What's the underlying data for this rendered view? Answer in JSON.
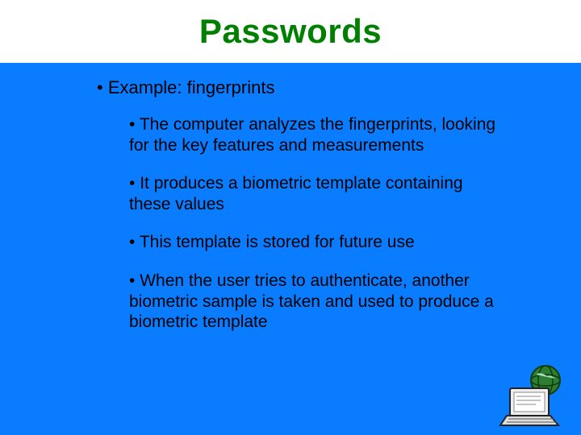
{
  "title": "Passwords",
  "example_label": "Example:  fingerprints",
  "sub_bullets": [
    "The computer analyzes the fingerprints, looking for the key features and measurements",
    "It produces a biometric template containing these values",
    "This template is stored for future use",
    "When the user tries to authenticate, another biometric sample is taken and used to produce a biometric template"
  ],
  "colors": {
    "background": "#0a7cff",
    "title": "#008000"
  }
}
